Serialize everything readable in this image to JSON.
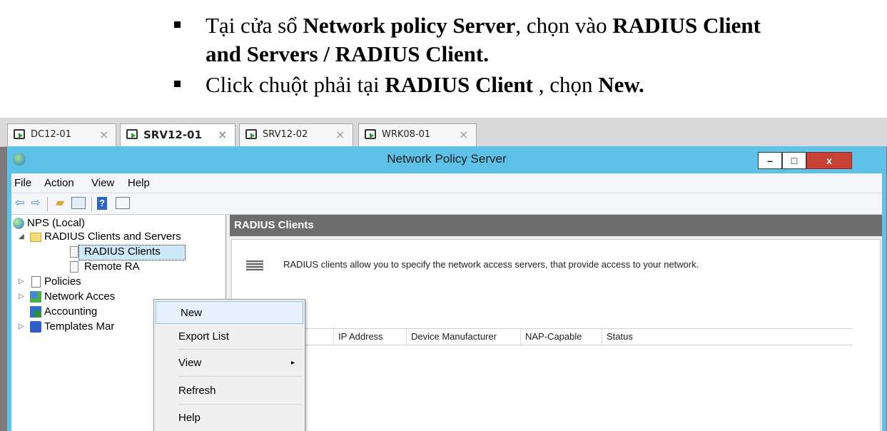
{
  "instructions": {
    "bullet1": {
      "t1": "Tại cửa sổ ",
      "b1": "Network policy Server",
      "t2": ", chọn vào ",
      "b2": "RADIUS Client",
      "cont": "and Servers / RADIUS Client."
    },
    "bullet2": {
      "t1": "Click chuột phải tại ",
      "b1": "RADIUS Client",
      "t2": " , chọn ",
      "b2": "New."
    }
  },
  "tabs": [
    {
      "label": "DC12-01",
      "close": "×"
    },
    {
      "label": "SRV12-01",
      "close": "×"
    },
    {
      "label": "SRV12-02",
      "close": "×"
    },
    {
      "label": "WRK08-01",
      "close": "×"
    }
  ],
  "window": {
    "title": "Network Policy Server",
    "min": "–",
    "max": "□",
    "close": "x"
  },
  "menubar": [
    "File",
    "Action",
    "View",
    "Help"
  ],
  "tree": [
    {
      "label": "NPS (Local)",
      "icon": "globe-icon"
    },
    {
      "label": "RADIUS Clients and Servers",
      "icon": "folder-icon",
      "expander": "◢"
    },
    {
      "label": "RADIUS Clients",
      "icon": "document-icon"
    },
    {
      "label": "Remote RA",
      "icon": "document-icon"
    },
    {
      "label": "Policies",
      "icon": "policies-icon",
      "expander": "▷"
    },
    {
      "label": "Network Acces",
      "icon": "network-icon",
      "expander": "▷"
    },
    {
      "label": "Accounting",
      "icon": "accounting-icon"
    },
    {
      "label": "Templates Mar",
      "icon": "templates-icon",
      "expander": "▷"
    }
  ],
  "main": {
    "header": "RADIUS Clients",
    "description": "RADIUS clients allow you to specify the network access servers, that provide access to your network.",
    "columns": [
      "IP Address",
      "Device Manufacturer",
      "NAP-Capable",
      "Status"
    ]
  },
  "context_menu": {
    "items": [
      "New",
      "Export List",
      "View",
      "Refresh",
      "Help"
    ],
    "submenu_arrow": "▸"
  },
  "colors": {
    "window_accent": "#5ec2e8",
    "close_button": "#c74135",
    "header_bg": "#6d6d6d"
  }
}
